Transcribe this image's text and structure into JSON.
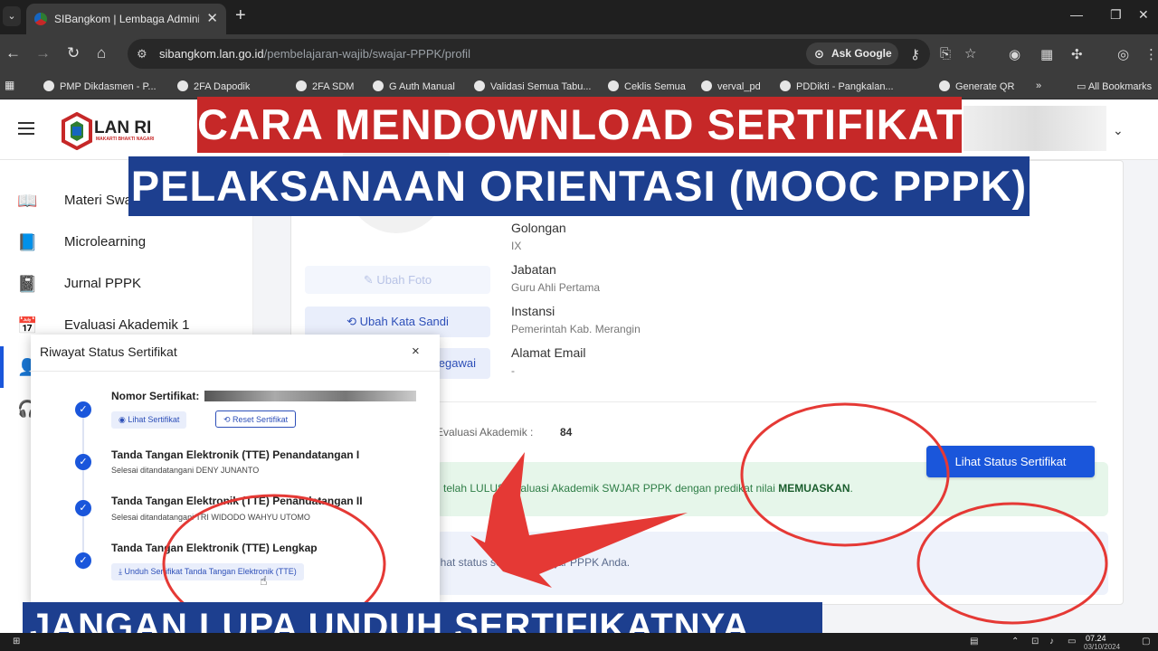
{
  "browser": {
    "tab_title": "SIBangkom | Lembaga Administrasi Negara",
    "url_host": "sibangkom.lan.go.id",
    "url_path": "/pembelajaran-wajib/swajar-PPPK/profil",
    "ask_google": "Ask Google",
    "bookmarks": [
      "PMP Dikdasmen - P...",
      "2FA Dapodik",
      "2FA SDM",
      "G Auth Manual",
      "Validasi Semua Tabu...",
      "Ceklis Semua",
      "verval_pd",
      "PDDikti - Pangkalan...",
      "Generate QR"
    ],
    "all_bookmarks": "All Bookmarks"
  },
  "header": {
    "logo_text": "LAN RI",
    "logo_sub": "MAKARTI BHAKTI NAGARI"
  },
  "sidebar": {
    "items": [
      "Materi Swajar",
      "Microlearning",
      "Jurnal PPPK",
      "Evaluasi Akademik 1"
    ]
  },
  "profile": {
    "btn_photo": "Ubah Foto",
    "btn_password": "Ubah Kata Sandi",
    "btn_pegawai": "Data Pegawai",
    "fields": [
      {
        "label": "Golongan",
        "value": "IX"
      },
      {
        "label": "Jabatan",
        "value": "Guru Ahli Pertama"
      },
      {
        "label": "Instansi",
        "value": "Pemerintah Kab. Merangin"
      },
      {
        "label": "Alamat Email",
        "value": "-"
      }
    ],
    "eval_label": "Evaluasi Akademik :",
    "eval_value": "84",
    "success_pre": "telah LULUS Evaluasi Akademik SWJAR PPPK dengan predikat nilai ",
    "success_bold": "MEMUASKAN",
    "success_post": ".",
    "info_text": "ihat status sertifikat Swajar PPPK Anda.",
    "btn_status": "Lihat Status Sertifikat"
  },
  "modal": {
    "title": "Riwayat Status Sertifikat",
    "close": "×",
    "cert_label": "Nomor Sertifikat:",
    "btn_view": "Lihat Sertifikat",
    "btn_reset": "Reset Sertifikat",
    "steps": [
      {
        "title": "Tanda Tangan Elektronik (TTE) Penandatangan I",
        "sub": "Selesai ditandatangani DENY JUNANTO"
      },
      {
        "title": "Tanda Tangan Elektronik (TTE) Penandatangan II",
        "sub": "Selesai ditandatangani TRI WIDODO WAHYU UTOMO"
      },
      {
        "title": "Tanda Tangan Elektronik (TTE) Lengkap",
        "sub": ""
      }
    ],
    "btn_download": "Unduh Sertifikat Tanda Tangan Elektronik (TTE)"
  },
  "overlay": {
    "title_line1": "CARA MENDOWNLOAD SERTIFIKAT",
    "title_line2": "PELAKSANAAN ORIENTASI (MOOC PPPK)",
    "caption": "JANGAN LUPA UNDUH SERTIFIKATNYA......."
  },
  "taskbar": {
    "time": "07.24",
    "date": "03/10/2024"
  },
  "colors": {
    "primary": "#1a56db",
    "red_banner": "#c62828",
    "blue_banner": "#1d3f8f",
    "annotation": "#e53935"
  }
}
